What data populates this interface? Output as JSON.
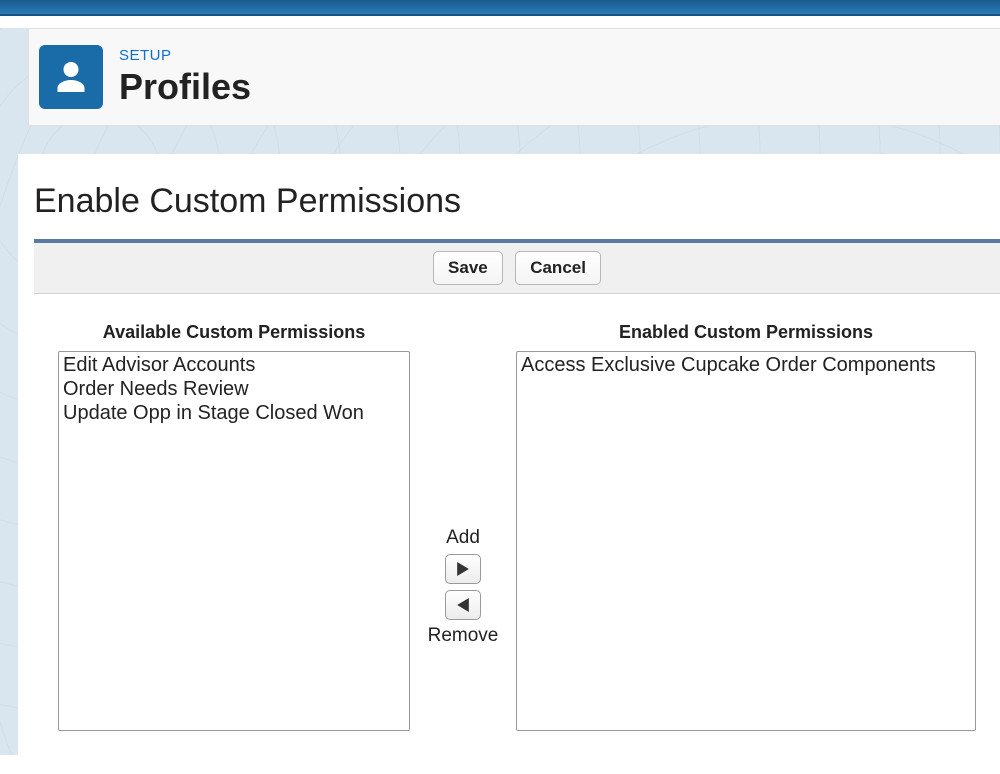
{
  "header": {
    "breadcrumb": "SETUP",
    "title": "Profiles"
  },
  "page": {
    "heading": "Enable Custom Permissions"
  },
  "toolbar": {
    "save": "Save",
    "cancel": "Cancel"
  },
  "dualList": {
    "availableTitle": "Available Custom Permissions",
    "enabledTitle": "Enabled Custom Permissions",
    "addLabel": "Add",
    "removeLabel": "Remove",
    "available": [
      "Edit Advisor Accounts",
      "Order Needs Review",
      "Update Opp in Stage Closed Won"
    ],
    "enabled": [
      "Access Exclusive Cupcake Order Components"
    ]
  }
}
